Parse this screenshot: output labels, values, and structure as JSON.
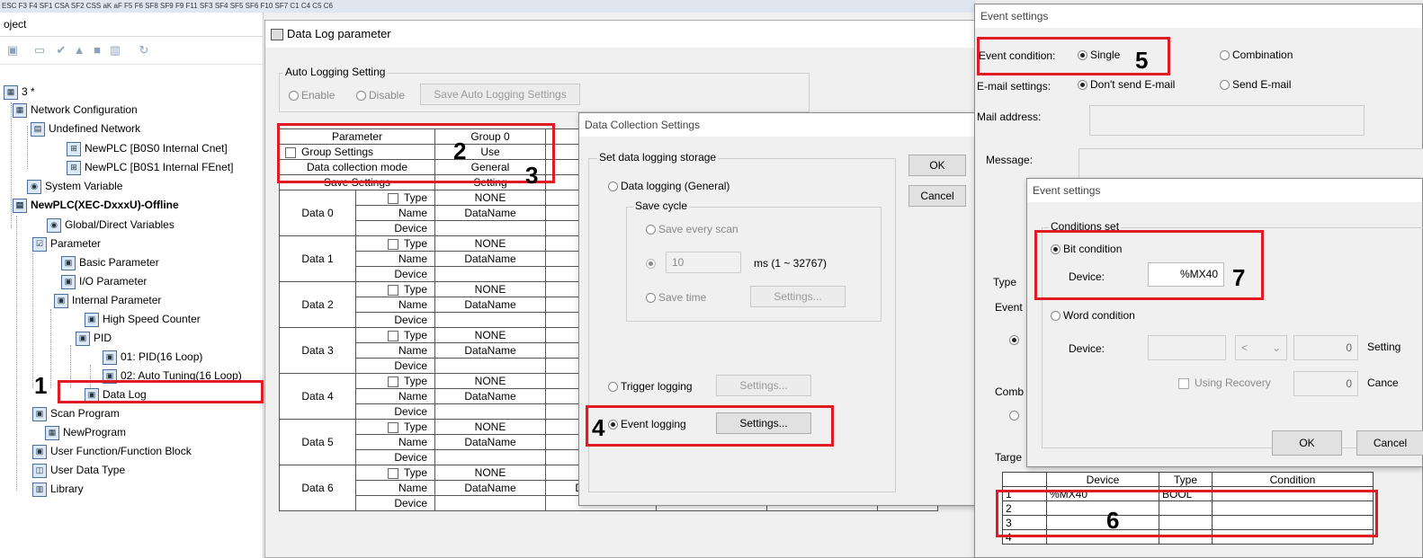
{
  "fn_strip": "ESC F3 F4 SF1 CSA SF2 CSS aK aF F5 F6 SF8 SF9 F9 F11 SF3 SF4 SF5 SF6 F10 SF7 C1 C4 C5 C6",
  "project": {
    "header": "oject",
    "tree": [
      {
        "label": "3 *",
        "icon": "project-icon"
      },
      {
        "label": "Network Configuration",
        "icon": "network-icon"
      },
      {
        "label": "Undefined Network",
        "icon": "network-folder-icon"
      },
      {
        "label": "NewPLC [B0S0 Internal Cnet]",
        "icon": "cnet-icon"
      },
      {
        "label": "NewPLC [B0S1 Internal FEnet]",
        "icon": "fenet-icon"
      },
      {
        "label": "System Variable",
        "icon": "variable-icon"
      },
      {
        "label": "NewPLC(XEC-DxxxU)-Offline",
        "icon": "plc-icon"
      },
      {
        "label": "Global/Direct Variables",
        "icon": "variable-icon"
      },
      {
        "label": "Parameter",
        "icon": "parameter-icon"
      },
      {
        "label": "Basic Parameter",
        "icon": "param-item-icon"
      },
      {
        "label": "I/O Parameter",
        "icon": "param-item-icon"
      },
      {
        "label": "Internal Parameter",
        "icon": "param-item-icon"
      },
      {
        "label": "High Speed Counter",
        "icon": "param-item-icon"
      },
      {
        "label": "PID",
        "icon": "param-item-icon"
      },
      {
        "label": "01: PID(16 Loop)",
        "icon": "param-item-icon"
      },
      {
        "label": "02: Auto Tuning(16 Loop)",
        "icon": "param-item-icon"
      },
      {
        "label": "Data Log",
        "icon": "param-item-icon"
      },
      {
        "label": "Scan Program",
        "icon": "scan-icon"
      },
      {
        "label": "NewProgram",
        "icon": "program-icon"
      },
      {
        "label": "User Function/Function Block",
        "icon": "function-icon"
      },
      {
        "label": "User Data Type",
        "icon": "datatype-icon"
      },
      {
        "label": "Library",
        "icon": "library-icon"
      }
    ]
  },
  "data_log_window": {
    "title": "Data Log parameter",
    "auto_logging": {
      "label": "Auto Logging Setting",
      "enable": "Enable",
      "disable": "Disable",
      "save_button": "Save Auto Logging Settings"
    },
    "grid": {
      "parameter": "Parameter",
      "group0": "Group 0",
      "group_settings": "Group Settings",
      "use": "Use",
      "data_collection_mode": "Data collection mode",
      "general": "General",
      "save_settings": "Save Settings",
      "setting": "Setting",
      "type": "Type",
      "name": "Name",
      "device": "Device",
      "none": "NONE",
      "dataname": "DataName",
      "rows": [
        "Data 0",
        "Data 1",
        "Data 2",
        "Data 3",
        "Data 4",
        "Data 5",
        "Data 6"
      ]
    }
  },
  "data_collection": {
    "title": "Data Collection Settings",
    "storage_label": "Set data logging storage",
    "general": "Data logging (General)",
    "save_cycle": "Save cycle",
    "save_every_scan": "Save every scan",
    "ms_value": "10",
    "ms_range": "ms (1 ~ 32767)",
    "save_time": "Save time",
    "settings": "Settings...",
    "trigger": "Trigger logging",
    "event": "Event logging",
    "ok": "OK",
    "cancel": "Cancel"
  },
  "event_settings": {
    "title": "Event settings",
    "event_condition": "Event condition:",
    "single": "Single",
    "combination": "Combination",
    "email_settings": "E-mail settings:",
    "dont_send": "Don't send E-mail",
    "send_email": "Send E-mail",
    "mail_address": "Mail address:",
    "message": "Message:",
    "type": "Type",
    "event": "Event",
    "comb": "Comb",
    "target": "Targe",
    "grid_headers": [
      "Device",
      "Type",
      "Condition"
    ],
    "grid_rows": [
      {
        "no": "1",
        "device": "%MX40",
        "type": "BOOL",
        "condition": ""
      },
      {
        "no": "2",
        "device": "",
        "type": "",
        "condition": ""
      },
      {
        "no": "3",
        "device": "",
        "type": "",
        "condition": ""
      },
      {
        "no": "4",
        "device": "",
        "type": "",
        "condition": ""
      }
    ]
  },
  "event_settings_inner": {
    "title": "Event settings",
    "conditions_set": "Conditions set",
    "bit_condition": "Bit condition",
    "device_label": "Device:",
    "device_value": "%MX40",
    "word_condition": "Word condition",
    "word_value": "0",
    "word_value2": "0",
    "operator": "<",
    "setting": "Setting",
    "using_recovery": "Using Recovery",
    "cancel_trunc": "Cance",
    "ok": "OK",
    "cancel": "Cancel"
  },
  "callouts": [
    "1",
    "2",
    "3",
    "4",
    "5",
    "6",
    "7"
  ],
  "colors": {
    "callout": "#e01b24"
  }
}
